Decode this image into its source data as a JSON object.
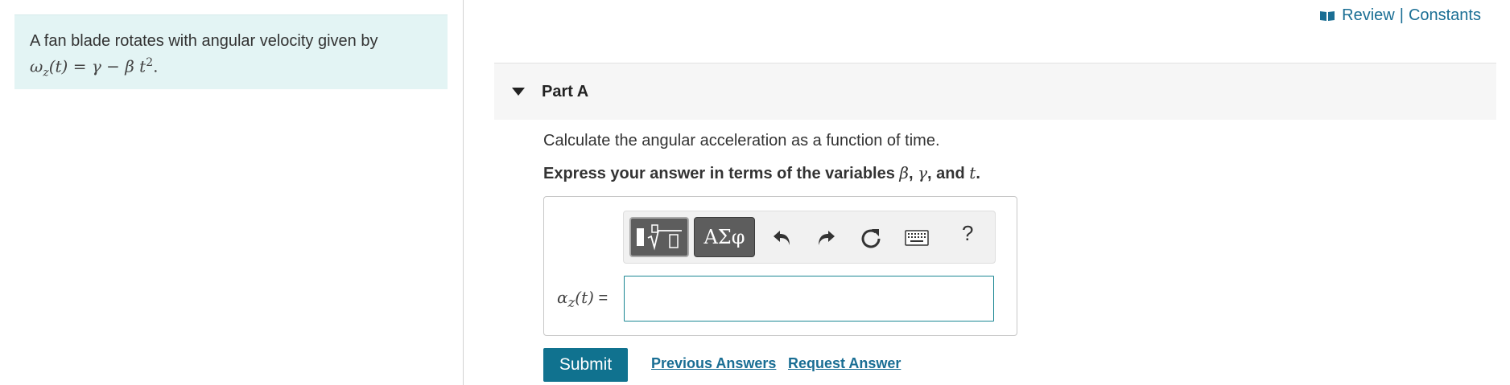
{
  "intro": {
    "text": "A fan blade rotates with angular velocity given by",
    "equation_omega": "ω",
    "equation_sub": "z",
    "equation_rest": "(t) = γ − β t",
    "equation_sup": "2",
    "equation_end": "."
  },
  "header": {
    "review": "Review",
    "separator": "|",
    "constants": "Constants"
  },
  "part": {
    "title": "Part A",
    "question": "Calculate the angular acceleration as a function of time.",
    "instruction_prefix": "Express your answer in terms of the variables ",
    "var_beta": "β",
    "comma1": ", ",
    "var_gamma": "γ",
    "instruction_and": ", and ",
    "var_t": "t",
    "instruction_end": "."
  },
  "toolbar": {
    "greek_label": "ΑΣφ",
    "help_label": "?",
    "icons": [
      "templates-icon",
      "greek-symbols-icon",
      "undo-icon",
      "redo-icon",
      "reset-icon",
      "keyboard-icon",
      "help-icon"
    ]
  },
  "answer": {
    "label_alpha": "α",
    "label_sub": "z",
    "label_rest": "(t)",
    "equals": "=",
    "value": ""
  },
  "actions": {
    "submit": "Submit",
    "previous_answers": "Previous Answers",
    "request_answer": "Request Answer"
  },
  "colors": {
    "intro_bg": "#e3f4f4",
    "accent": "#10728f",
    "link": "#1a6e94",
    "input_border": "#1b8794",
    "toolbar_button": "#5d5d5d"
  }
}
